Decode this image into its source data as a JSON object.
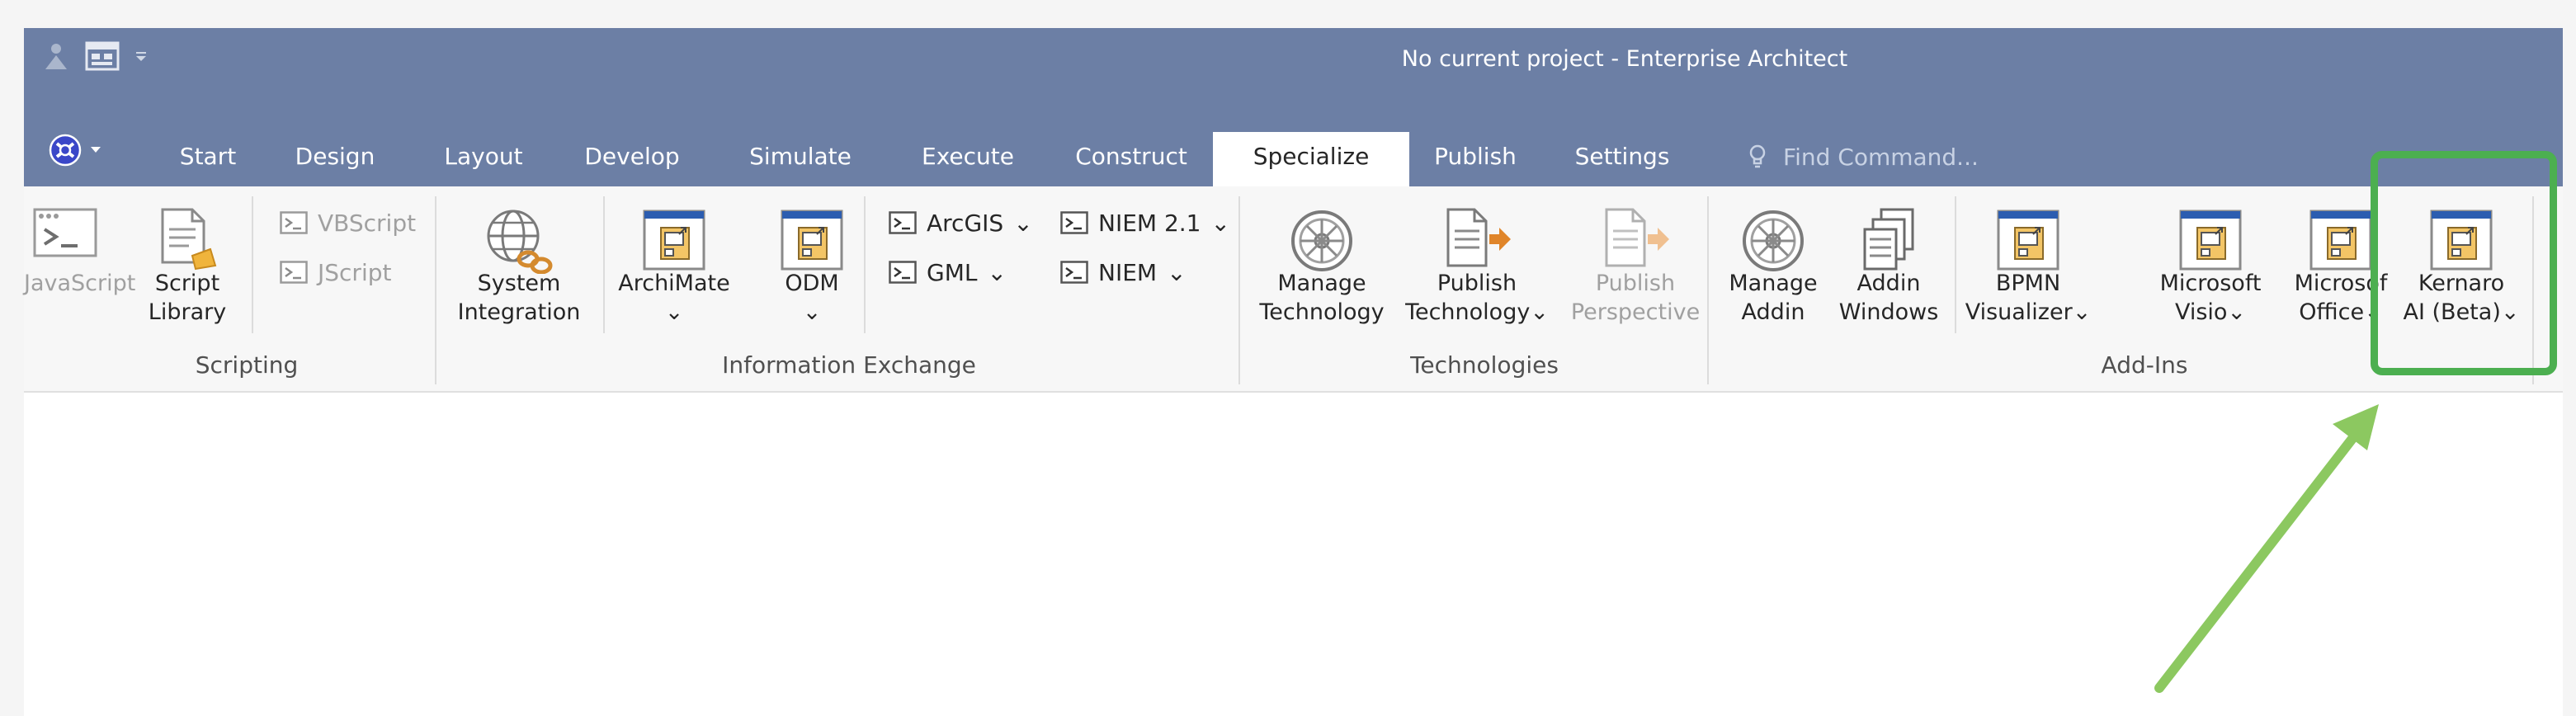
{
  "window": {
    "title": "No current project - Enterprise Architect"
  },
  "tabs": [
    {
      "label": "Start"
    },
    {
      "label": "Design"
    },
    {
      "label": "Layout"
    },
    {
      "label": "Develop"
    },
    {
      "label": "Simulate"
    },
    {
      "label": "Execute"
    },
    {
      "label": "Construct"
    },
    {
      "label": "Specialize",
      "active": true
    },
    {
      "label": "Publish"
    },
    {
      "label": "Settings"
    }
  ],
  "find_command": {
    "placeholder": "Find Command..."
  },
  "ribbon": {
    "scripting": {
      "label": "Scripting",
      "javascript": "JavaScript",
      "script_library": [
        "Script",
        "Library"
      ],
      "vbscript": "VBScript",
      "jscript": "JScript"
    },
    "information_exchange": {
      "label": "Information Exchange",
      "system_integration": [
        "System",
        "Integration"
      ],
      "archimate": "ArchiMate",
      "odm": "ODM",
      "arcgis": "ArcGIS",
      "gml": "GML",
      "niem21": "NIEM 2.1",
      "niem": "NIEM"
    },
    "technologies": {
      "label": "Technologies",
      "manage_technology": [
        "Manage",
        "Technology"
      ],
      "publish_technology": [
        "Publish",
        "Technology"
      ],
      "publish_perspective": [
        "Publish",
        "Perspective"
      ]
    },
    "addins": {
      "label": "Add-Ins",
      "manage_addin": [
        "Manage",
        "Addin"
      ],
      "addin_windows": [
        "Addin",
        "Windows"
      ],
      "bpmn_visualizer": [
        "BPMN",
        "Visualizer"
      ],
      "microsoft_visio": [
        "Microsoft",
        "Visio"
      ],
      "microsoft_office": [
        "Microsof",
        "Office"
      ],
      "kernaro_ai": [
        "Kernaro",
        "AI (Beta)"
      ]
    }
  },
  "colors": {
    "title_bar": "#6c7fa5",
    "highlight_box": "#4caf50",
    "arrow": "#8cc860"
  }
}
